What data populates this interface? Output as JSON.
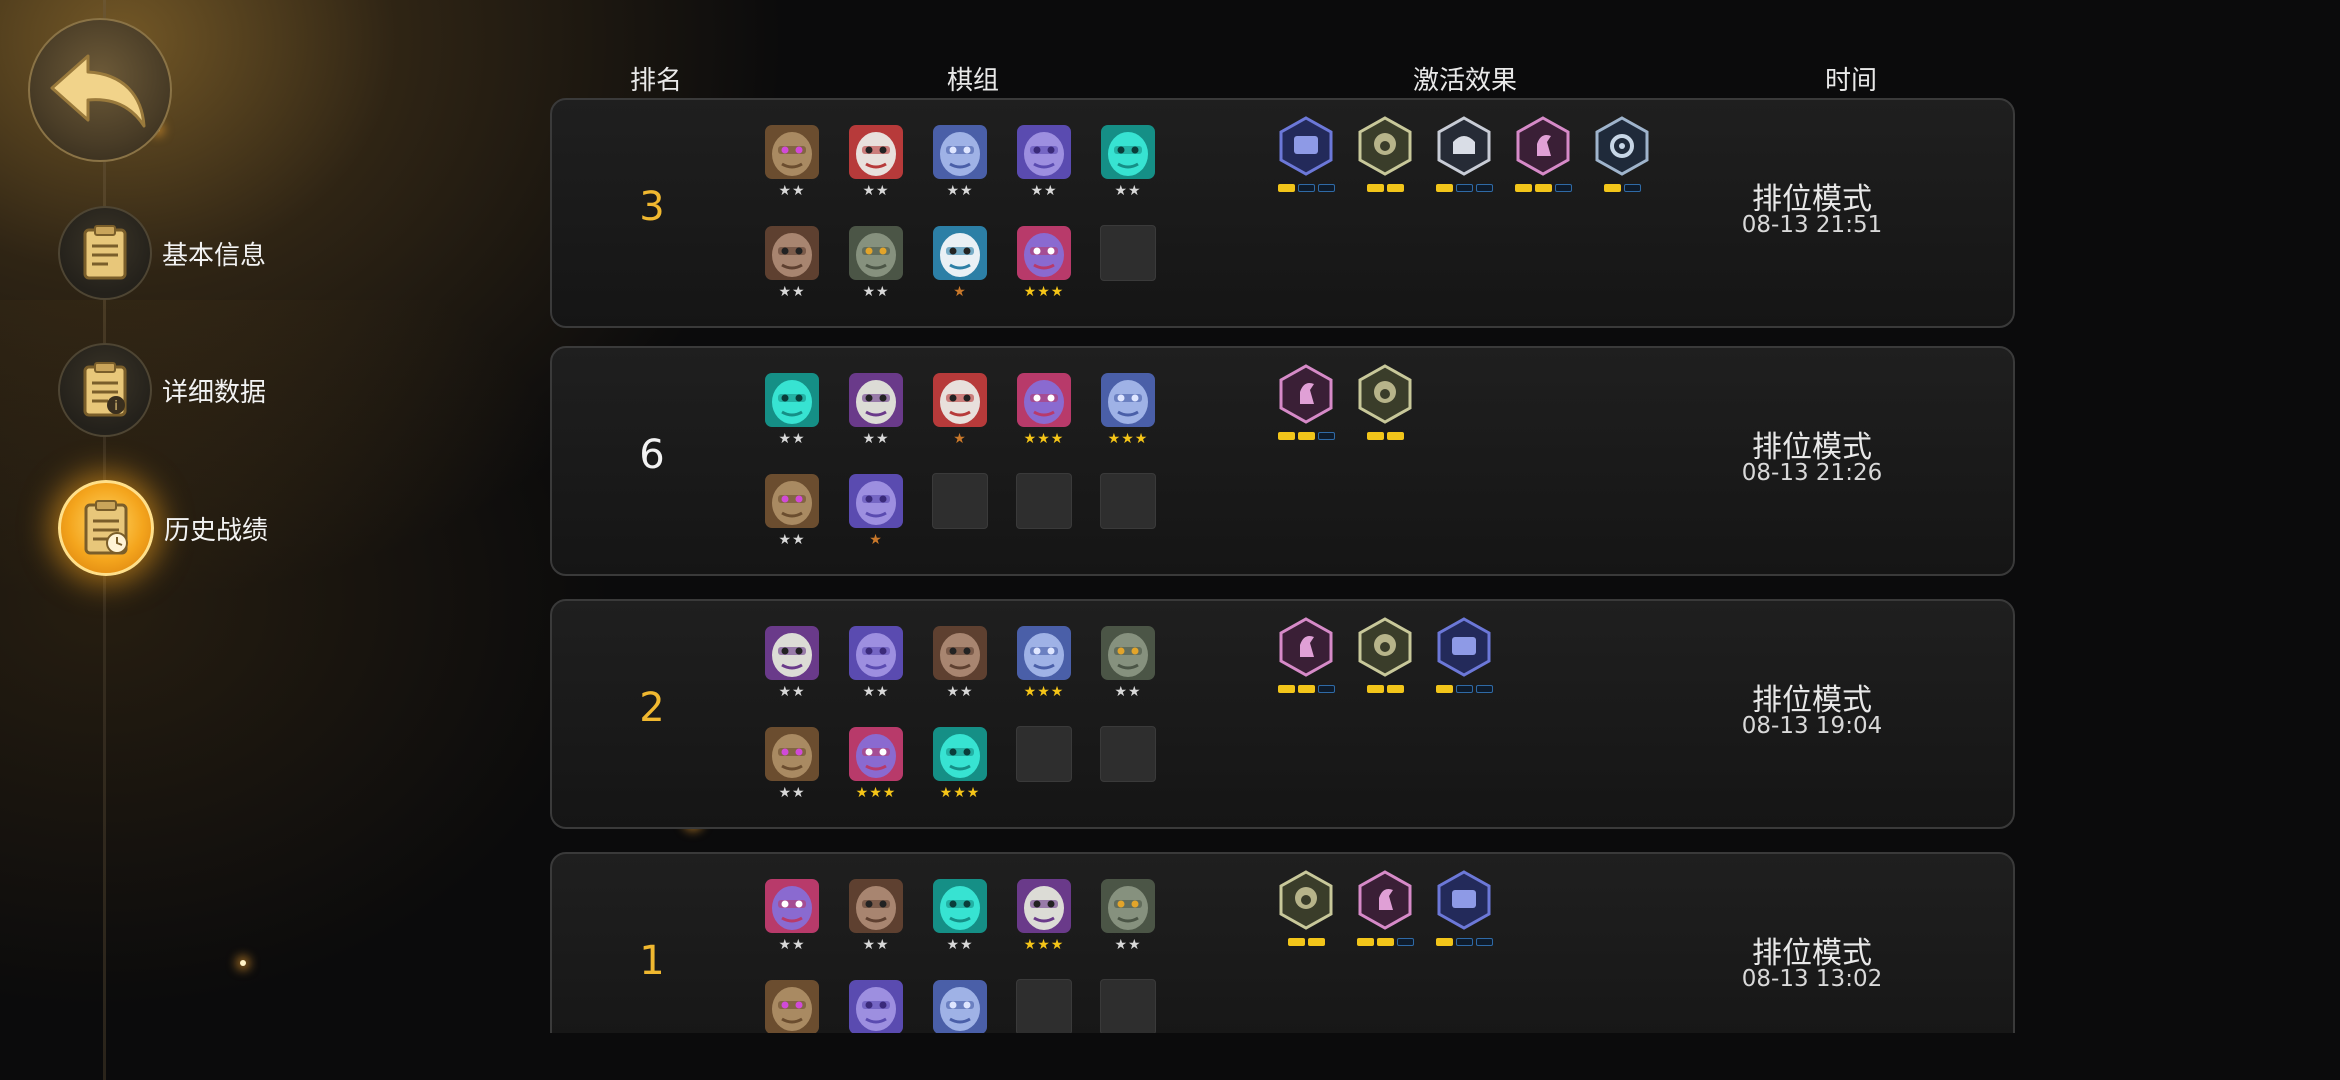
{
  "back_button": {
    "icon": "back-arrow-icon"
  },
  "nav": [
    {
      "label": "基本信息",
      "icon": "clipboard-icon",
      "active": false
    },
    {
      "label": "详细数据",
      "icon": "clipboard-info-icon",
      "active": false
    },
    {
      "label": "历史战绩",
      "icon": "clipboard-clock-icon",
      "active": true
    }
  ],
  "headers": {
    "rank": "排名",
    "lineup": "棋组",
    "effects": "激活效果",
    "time": "时间"
  },
  "matches": [
    {
      "rank": "3",
      "rank_color": "gold",
      "mode": "排位模式",
      "date": "08-13 21:51",
      "pieces": [
        {
          "kind": "wood",
          "stars": 2
        },
        {
          "kind": "yeti",
          "stars": 2
        },
        {
          "kind": "knight",
          "stars": 2
        },
        {
          "kind": "golem",
          "stars": 2
        },
        {
          "kind": "cyan",
          "stars": 2
        },
        {
          "kind": "ogre",
          "stars": 2
        },
        {
          "kind": "tank",
          "stars": 2
        },
        {
          "kind": "mage",
          "stars": 1
        },
        {
          "kind": "bat",
          "stars": 3
        },
        {
          "kind": "empty",
          "stars": 0
        }
      ],
      "effects": [
        {
          "icon": "navy",
          "on": 1,
          "total": 3
        },
        {
          "icon": "olive",
          "on": 2,
          "total": 2
        },
        {
          "icon": "steel",
          "on": 1,
          "total": 3
        },
        {
          "icon": "pink",
          "on": 2,
          "total": 3
        },
        {
          "icon": "gear",
          "on": 1,
          "total": 2
        }
      ]
    },
    {
      "rank": "6",
      "rank_color": "white",
      "mode": "排位模式",
      "date": "08-13 21:26",
      "pieces": [
        {
          "kind": "cyan",
          "stars": 2
        },
        {
          "kind": "elder",
          "stars": 2
        },
        {
          "kind": "yeti",
          "stars": 1
        },
        {
          "kind": "bat",
          "stars": 3
        },
        {
          "kind": "knight",
          "stars": 3
        },
        {
          "kind": "wood",
          "stars": 2
        },
        {
          "kind": "golem",
          "stars": 1
        },
        {
          "kind": "empty",
          "stars": 0
        },
        {
          "kind": "empty",
          "stars": 0
        },
        {
          "kind": "empty",
          "stars": 0
        }
      ],
      "effects": [
        {
          "icon": "pink",
          "on": 2,
          "total": 3
        },
        {
          "icon": "olive",
          "on": 2,
          "total": 2
        }
      ]
    },
    {
      "rank": "2",
      "rank_color": "gold",
      "mode": "排位模式",
      "date": "08-13 19:04",
      "pieces": [
        {
          "kind": "elder",
          "stars": 2
        },
        {
          "kind": "golem",
          "stars": 2
        },
        {
          "kind": "ogre",
          "stars": 2
        },
        {
          "kind": "knight",
          "stars": 3
        },
        {
          "kind": "tank",
          "stars": 2
        },
        {
          "kind": "wood",
          "stars": 2
        },
        {
          "kind": "bat",
          "stars": 3
        },
        {
          "kind": "cyan",
          "stars": 3
        },
        {
          "kind": "empty",
          "stars": 0
        },
        {
          "kind": "empty",
          "stars": 0
        }
      ],
      "effects": [
        {
          "icon": "pink",
          "on": 2,
          "total": 3
        },
        {
          "icon": "olive",
          "on": 2,
          "total": 2
        },
        {
          "icon": "navy",
          "on": 1,
          "total": 3
        }
      ]
    },
    {
      "rank": "1",
      "rank_color": "gold",
      "mode": "排位模式",
      "date": "08-13 13:02",
      "pieces": [
        {
          "kind": "bat",
          "stars": 2
        },
        {
          "kind": "ogre",
          "stars": 2
        },
        {
          "kind": "cyan",
          "stars": 2
        },
        {
          "kind": "elder",
          "stars": 3
        },
        {
          "kind": "tank",
          "stars": 2
        },
        {
          "kind": "wood",
          "stars": 0
        },
        {
          "kind": "golem",
          "stars": 0
        },
        {
          "kind": "knight",
          "stars": 0
        },
        {
          "kind": "empty",
          "stars": 0
        },
        {
          "kind": "empty",
          "stars": 0
        }
      ],
      "effects": [
        {
          "icon": "olive",
          "on": 2,
          "total": 2
        },
        {
          "icon": "pink",
          "on": 2,
          "total": 3
        },
        {
          "icon": "navy",
          "on": 1,
          "total": 3
        }
      ]
    }
  ],
  "colors": {
    "accent_gold": "#f0b830",
    "bar_on": "#f2c51a",
    "bar_off_border": "#2f6aa6"
  }
}
